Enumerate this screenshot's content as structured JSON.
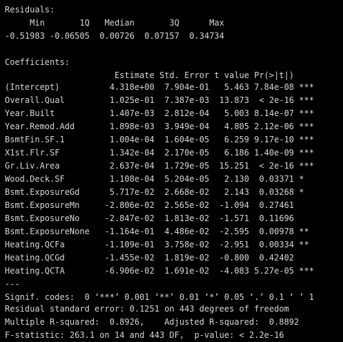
{
  "theme": {
    "background": "#000000",
    "foreground": "#d8d8d8"
  },
  "console": {
    "lines": [
      "Residuals:",
      "     Min       1Q   Median       3Q      Max ",
      "-0.51983 -0.06505  0.00726  0.07157  0.34734 ",
      "",
      "Coefficients:",
      "                      Estimate Std. Error t value Pr(>|t|)    ",
      "(Intercept)          4.318e+00  7.904e-01   5.463 7.84e-08 ***",
      "Overall.Qual         1.025e-01  7.387e-03  13.873  < 2e-16 ***",
      "Year.Built           1.407e-03  2.812e-04   5.003 8.14e-07 ***",
      "Year.Remod.Add       1.898e-03  3.949e-04   4.805 2.12e-06 ***",
      "BsmtFin.SF.1         1.004e-04  1.604e-05   6.259 9.17e-10 ***",
      "X1st.Flr.SF          1.342e-04  2.170e-05   6.186 1.40e-09 ***",
      "Gr.Liv.Area          2.637e-04  1.729e-05  15.251  < 2e-16 ***",
      "Wood.Deck.SF         1.108e-04  5.204e-05   2.130  0.03371 *  ",
      "Bsmt.ExposureGd      5.717e-02  2.668e-02   2.143  0.03268 *  ",
      "Bsmt.ExposureMn     -2.806e-02  2.565e-02  -1.094  0.27461    ",
      "Bsmt.ExposureNo     -2.847e-02  1.813e-02  -1.571  0.11696    ",
      "Bsmt.ExposureNone   -1.164e-01  4.486e-02  -2.595  0.00978 ** ",
      "Heating.QCFa        -1.109e-01  3.758e-02  -2.951  0.00334 ** ",
      "Heating.QCGd        -1.455e-02  1.819e-02  -0.800  0.42402    ",
      "Heating.QCTA        -6.906e-02  1.691e-02  -4.083 5.27e-05 ***",
      "---",
      "Signif. codes:  0 ‘***’ 0.001 ‘**’ 0.01 ‘*’ 0.05 ‘.’ 0.1 ‘ ’ 1",
      "",
      "Residual standard error: 0.1251 on 443 degrees of freedom",
      "Multiple R-squared:  0.8926,    Adjusted R-squared:  0.8892 ",
      "F-statistic: 263.1 on 14 and 443 DF,  p-value: < 2.2e-16"
    ]
  }
}
